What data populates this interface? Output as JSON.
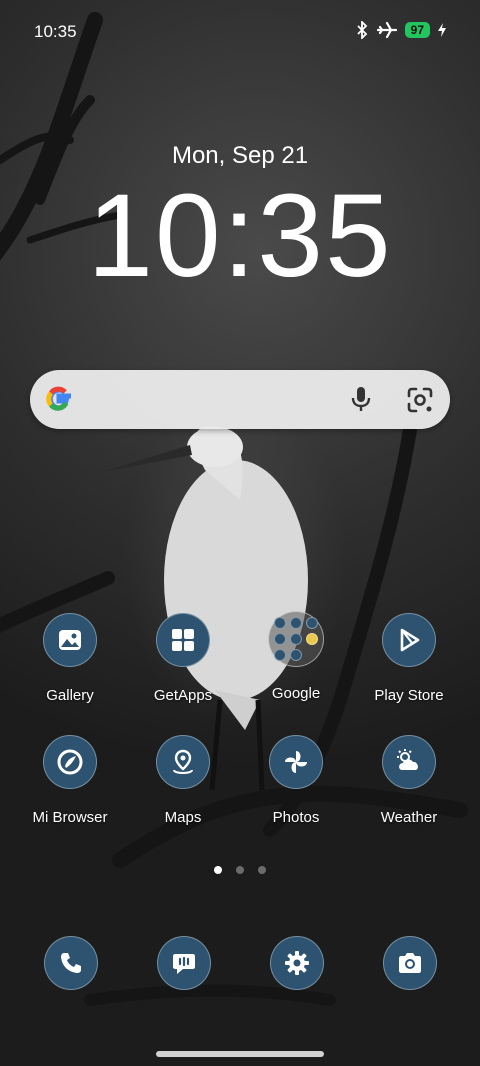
{
  "status_bar": {
    "time": "10:35",
    "icons": [
      "bluetooth-icon",
      "airplane-mode-icon",
      "battery-icon",
      "charging-bolt-icon"
    ],
    "battery_level": "97",
    "battery_color": "#22c55e"
  },
  "lockclock": {
    "date": "Mon, Sep 21",
    "time": "10:35"
  },
  "search": {
    "icons": [
      "google-g-logo",
      "microphone-icon",
      "google-lens-icon"
    ]
  },
  "apps_row1": [
    {
      "label": "Gallery",
      "icon": "gallery-icon"
    },
    {
      "label": "GetApps",
      "icon": "getapps-icon"
    },
    {
      "label": "Google",
      "icon": "google-folder"
    },
    {
      "label": "Play Store",
      "icon": "play-store-icon"
    }
  ],
  "apps_row2": [
    {
      "label": "Mi Browser",
      "icon": "mi-browser-icon"
    },
    {
      "label": "Maps",
      "icon": "maps-icon"
    },
    {
      "label": "Photos",
      "icon": "photos-icon"
    },
    {
      "label": "Weather",
      "icon": "weather-icon"
    }
  ],
  "page_indicator": {
    "count": 3,
    "active_page": 1
  },
  "dock": [
    "phone-icon",
    "messages-icon",
    "settings-icon",
    "camera-icon"
  ],
  "colors": {
    "icon_background": "#2d5370",
    "accent_text": "#ffffff"
  }
}
